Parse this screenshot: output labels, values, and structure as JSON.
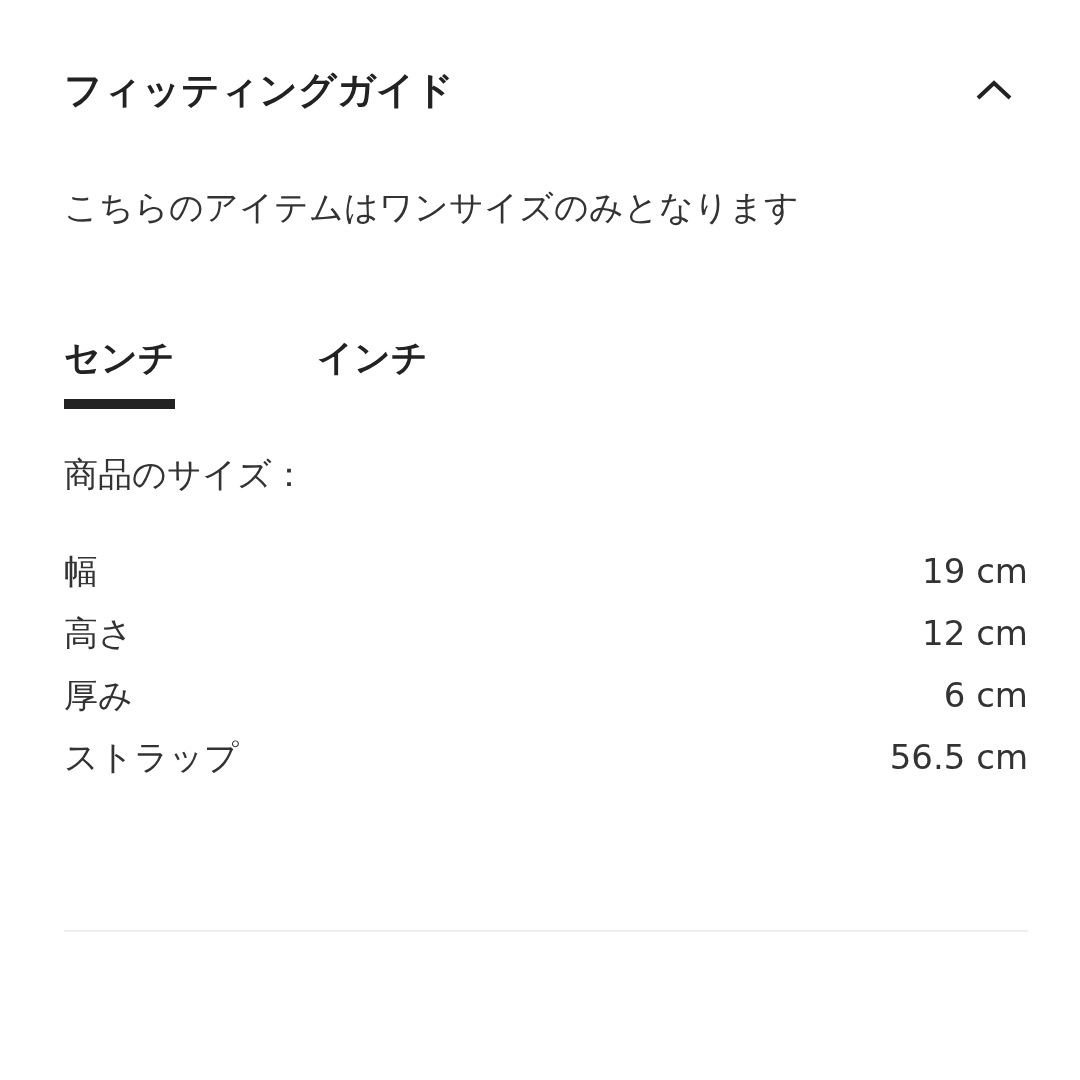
{
  "section": {
    "title": "フィッティングガイド",
    "expanded": true
  },
  "note": "こちらのアイテムはワンサイズのみとなります",
  "tabs": [
    {
      "label": "センチ",
      "selected": true
    },
    {
      "label": "インチ",
      "selected": false
    }
  ],
  "size_label": "商品のサイズ：",
  "sizes": [
    {
      "name": "幅",
      "value": "19 cm"
    },
    {
      "name": "高さ",
      "value": "12 cm"
    },
    {
      "name": "厚み",
      "value": "6 cm"
    },
    {
      "name": "ストラップ",
      "value": "56.5 cm"
    }
  ]
}
